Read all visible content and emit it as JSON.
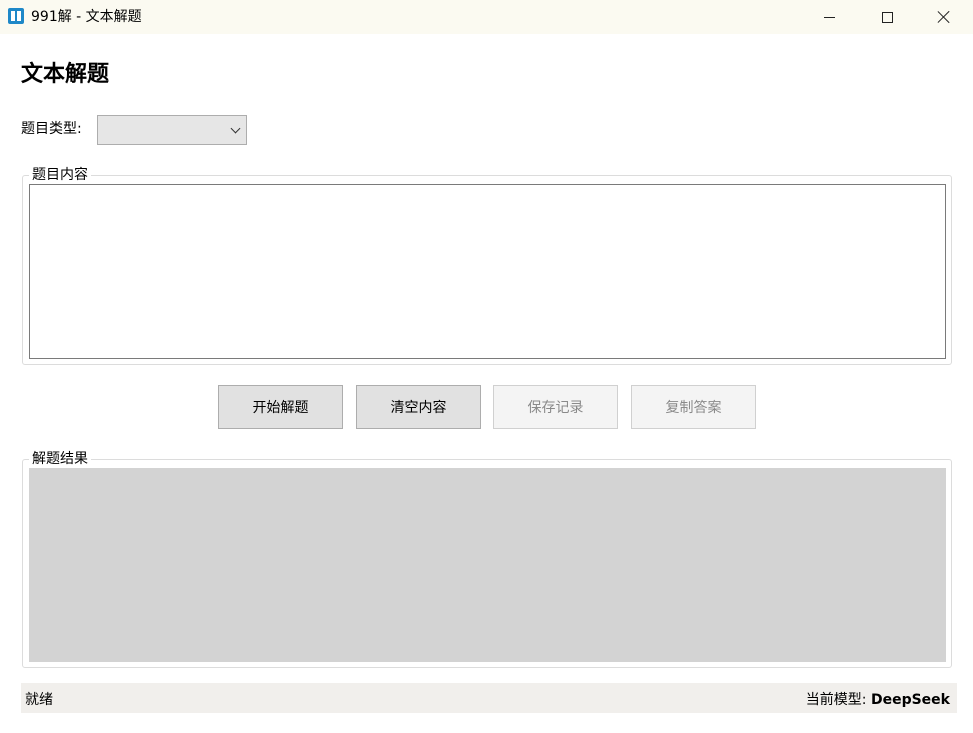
{
  "window": {
    "title": "991解 - 文本解题",
    "minimize": "minimize",
    "maximize": "maximize",
    "close": "close"
  },
  "page": {
    "title": "文本解题"
  },
  "question_type": {
    "label": "题目类型:",
    "selected": ""
  },
  "content_group": {
    "legend": "题目内容",
    "value": ""
  },
  "buttons": {
    "start": "开始解题",
    "clear": "清空内容",
    "save": "保存记录",
    "copy": "复制答案"
  },
  "result_group": {
    "legend": "解题结果",
    "value": ""
  },
  "status": {
    "text": "就绪",
    "model_label": "当前模型:",
    "model_name": "DeepSeek"
  },
  "colors": {
    "titlebar": "#fbfaf1",
    "result_background": "#d3d3d3",
    "statusbar": "#f1efec",
    "icon": "#1e88c8"
  }
}
